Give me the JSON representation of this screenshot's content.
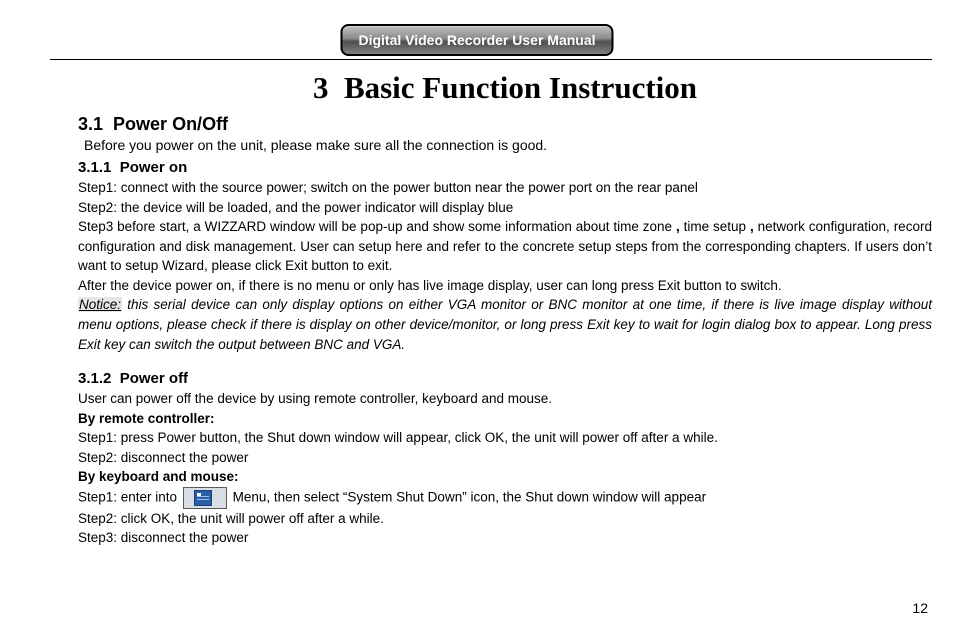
{
  "header": {
    "title": "Digital Video Recorder User Manual"
  },
  "chapter": {
    "number": "3",
    "title": "Basic Function Instruction"
  },
  "s31": {
    "num": "3.1",
    "title": "Power On/Off",
    "intro": "Before you power on the unit, please make sure all the connection is good."
  },
  "s311": {
    "num": "3.1.1",
    "title": "Power on",
    "step1": "Step1: connect with the source power; switch on the power button near the power port on the rear panel",
    "step2": "Step2: the device will be loaded, and the power indicator will display blue",
    "step3_a": "Step3 before start, a WIZZARD window will be pop-up and show some information about time zone",
    "step3_b": "time setup",
    "step3_c": "network configuration, record configuration and disk management. User can setup here and refer to the concrete setup steps from the corresponding chapters. If users don’t want to setup Wizard, please click Exit button to exit.",
    "after": "After the device power on, if there is no menu or only has live image display, user can long press Exit button to switch.",
    "notice_label": "Notice:",
    "notice_body": " this serial device can only display options on either VGA monitor or BNC monitor at one time, if there is live image display without menu options, please check if there is display on other device/monitor, or long press Exit key to wait for login dialog box to appear. Long press Exit key can switch the output between BNC and VGA."
  },
  "s312": {
    "num": "3.1.2",
    "title": "Power off",
    "intro": "User can power off the device by using remote controller, keyboard and mouse.",
    "remote_label": "By remote controller:",
    "r_step1": "Step1: press Power button, the Shut down window will appear, click OK, the unit will power off after a while.",
    "r_step2": "Step2: disconnect the power",
    "km_label": "By keyboard and mouse:",
    "k_step1_a": "Step1: enter into ",
    "k_step1_b": "Menu, then select “System Shut Down” icon, the Shut down window will appear",
    "k_step2": "Step2: click OK, the unit will power off after a while.",
    "k_step3": "Step3: disconnect the power"
  },
  "comma": ",",
  "page_number": "12"
}
